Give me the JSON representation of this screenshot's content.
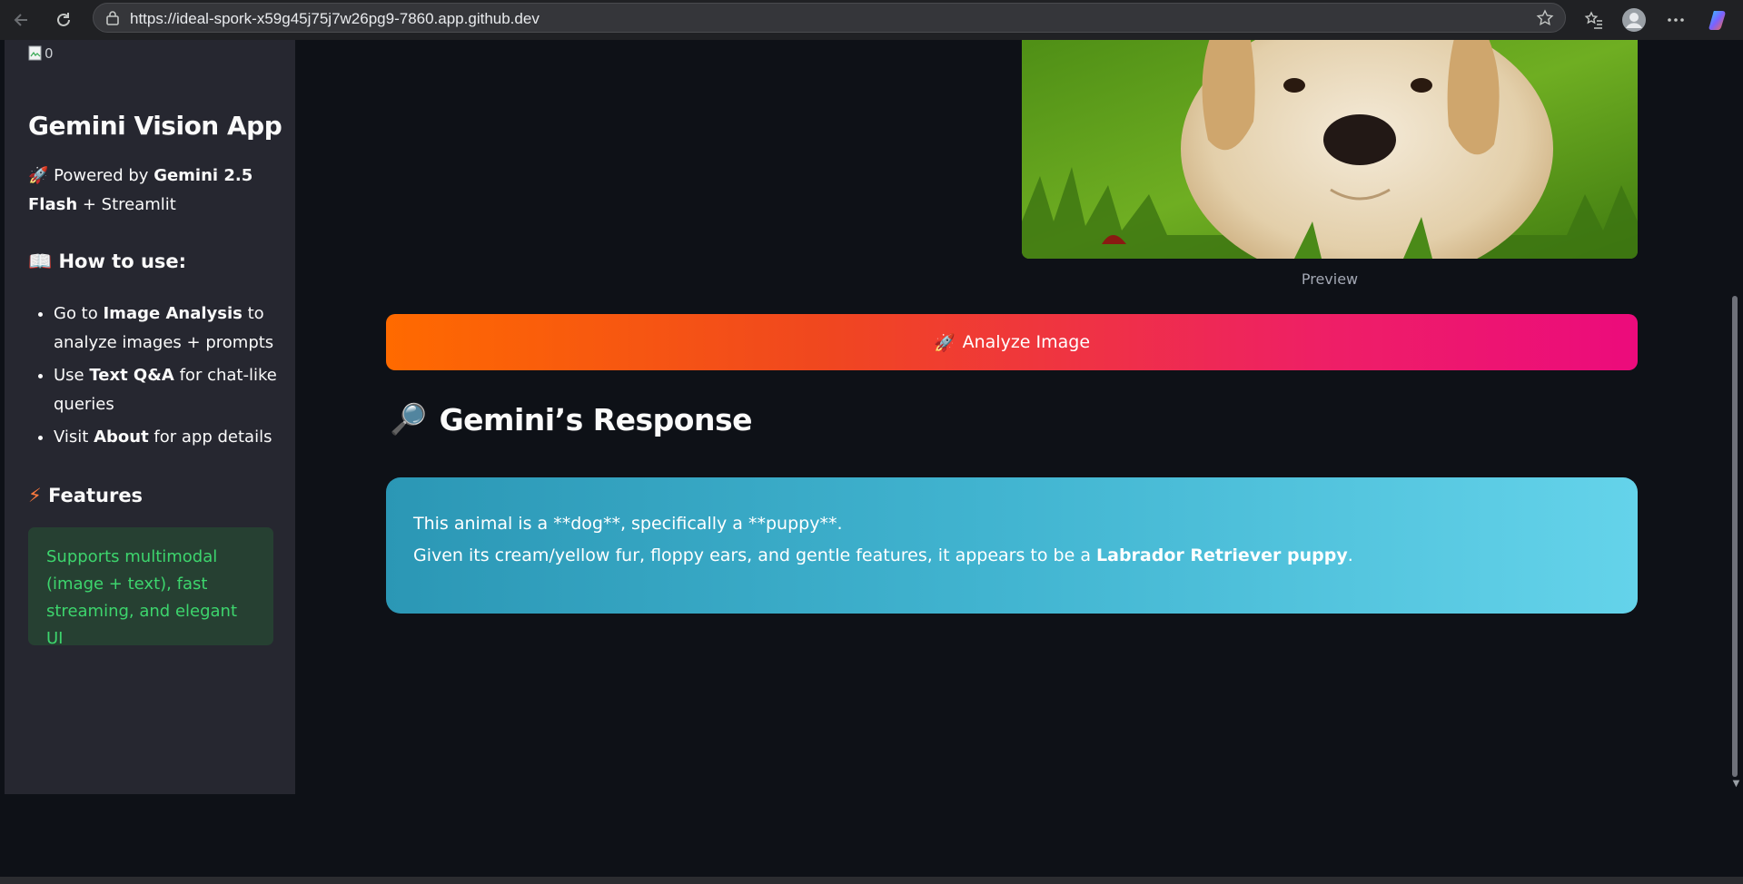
{
  "browser": {
    "url": "https://ideal-spork-x59g45j75j7w26pg9-7860.app.github.dev"
  },
  "sidebar": {
    "logo_alt": "0",
    "title": "Gemini Vision App",
    "powered_prefix": "🚀 Powered by ",
    "powered_model": "Gemini 2.5 Flash",
    "powered_suffix": " + Streamlit",
    "howto_icon": "📖",
    "howto_heading": "How to use:",
    "howto_items": [
      {
        "pre": "Go to ",
        "bold": "Image Analysis",
        "post": " to analyze images + prompts"
      },
      {
        "pre": "Use ",
        "bold": "Text Q&A",
        "post": " for chat-like queries"
      },
      {
        "pre": "Visit ",
        "bold": "About",
        "post": " for app details"
      }
    ],
    "features_icon": "⚡",
    "features_heading": "Features",
    "features_text": "Supports multimodal (image + text), fast streaming, and elegant UI"
  },
  "main": {
    "preview_caption": "Preview",
    "analyze_button_icon": "🚀",
    "analyze_button_label": "Analyze Image",
    "response_icon": "🔎",
    "response_heading": "Gemini’s Response",
    "response_line1": "This animal is a **dog**, specifically a **puppy**.",
    "response_line2_pre": "Given its cream/yellow fur, floppy ears, and gentle features, it appears to be a ",
    "response_line2_bold": "Labrador Retriever puppy",
    "response_line2_post": "."
  },
  "colors": {
    "app_bg": "#0e1117",
    "sidebar_bg": "#262730",
    "button_gradient_start": "#ff6a00",
    "button_gradient_end": "#ec0b7c",
    "response_gradient_start": "#2b97b5",
    "response_gradient_end": "#64d3ea",
    "success_text": "#3dd56d"
  }
}
